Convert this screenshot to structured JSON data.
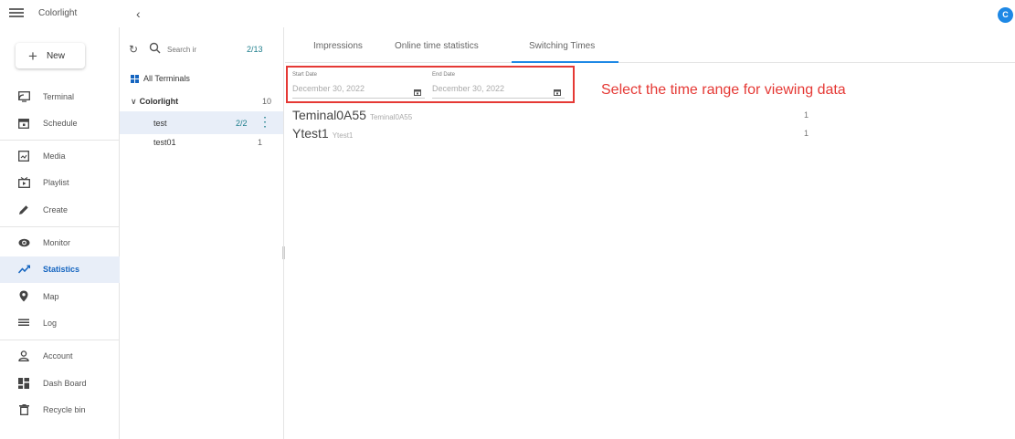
{
  "app": {
    "title": "Colorlight",
    "avatar_letter": "C"
  },
  "sidebar": {
    "new_label": "New",
    "groups": [
      [
        {
          "icon": "terminal-icon",
          "label": "Terminal"
        },
        {
          "icon": "schedule-icon",
          "label": "Schedule"
        }
      ],
      [
        {
          "icon": "media-icon",
          "label": "Media"
        },
        {
          "icon": "playlist-icon",
          "label": "Playlist"
        },
        {
          "icon": "create-icon",
          "label": "Create"
        }
      ],
      [
        {
          "icon": "monitor-icon",
          "label": "Monitor"
        },
        {
          "icon": "statistics-icon",
          "label": "Statistics",
          "active": true
        },
        {
          "icon": "map-icon",
          "label": "Map"
        },
        {
          "icon": "log-icon",
          "label": "Log"
        }
      ],
      [
        {
          "icon": "account-icon",
          "label": "Account"
        },
        {
          "icon": "dashboard-icon",
          "label": "Dash Board"
        },
        {
          "icon": "recycle-bin-icon",
          "label": "Recycle bin"
        }
      ]
    ]
  },
  "terminals": {
    "search_placeholder": "Search ir",
    "count": "2/13",
    "all_label": "All Terminals",
    "group": {
      "name": "Colorlight",
      "count": "10"
    },
    "items": [
      {
        "name": "test",
        "count": "2/2",
        "selected": true
      },
      {
        "name": "test01",
        "count": "1",
        "selected": false
      }
    ]
  },
  "tabs": [
    {
      "label": "Impressions"
    },
    {
      "label": "Online time statistics"
    },
    {
      "label": "Switching Times",
      "active": true
    }
  ],
  "filters": {
    "start_label": "Start Date",
    "start_value": "December 30, 2022",
    "end_label": "End Date",
    "end_value": "December 30, 2022"
  },
  "annotation": "Select the time range for viewing data",
  "results": [
    {
      "name": "Teminal0A55",
      "sub": "Teminal0A55",
      "count": "1"
    },
    {
      "name": "Ytest1",
      "sub": "Ytest1",
      "count": "1"
    }
  ],
  "colors": {
    "accent": "#1e88e5",
    "teal": "#1e7e8c",
    "highlight": "#e53935",
    "active_bg": "#e8eef8"
  }
}
